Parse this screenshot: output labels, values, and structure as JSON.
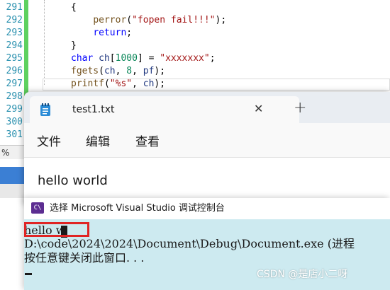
{
  "editor": {
    "line_numbers": [
      "291",
      "292",
      "293",
      "294",
      "295",
      "296",
      "297",
      "298",
      "299",
      "300",
      "301"
    ],
    "lines": [
      {
        "parts": [
          {
            "t": "{",
            "c": ""
          }
        ]
      },
      {
        "parts": [
          {
            "t": "    ",
            "c": ""
          },
          {
            "t": "perror",
            "c": "fn"
          },
          {
            "t": "(",
            "c": ""
          },
          {
            "t": "\"fopen fail!!!\"",
            "c": "str"
          },
          {
            "t": ");",
            "c": ""
          }
        ]
      },
      {
        "parts": [
          {
            "t": "    ",
            "c": ""
          },
          {
            "t": "return",
            "c": "kw"
          },
          {
            "t": ";",
            "c": ""
          }
        ]
      },
      {
        "parts": [
          {
            "t": "}",
            "c": ""
          }
        ]
      },
      {
        "parts": [
          {
            "t": "char",
            "c": "kw"
          },
          {
            "t": " ",
            "c": ""
          },
          {
            "t": "ch",
            "c": "vr"
          },
          {
            "t": "[",
            "c": ""
          },
          {
            "t": "1000",
            "c": "nm"
          },
          {
            "t": "] = ",
            "c": ""
          },
          {
            "t": "\"xxxxxxx\"",
            "c": "str"
          },
          {
            "t": ";",
            "c": ""
          }
        ]
      },
      {
        "parts": [
          {
            "t": "fgets",
            "c": "fn"
          },
          {
            "t": "(",
            "c": ""
          },
          {
            "t": "ch",
            "c": "vr"
          },
          {
            "t": ", ",
            "c": ""
          },
          {
            "t": "8",
            "c": "nm"
          },
          {
            "t": ", ",
            "c": ""
          },
          {
            "t": "pf",
            "c": "vr"
          },
          {
            "t": ");",
            "c": ""
          }
        ]
      },
      {
        "parts": [
          {
            "t": "printf",
            "c": "fn"
          },
          {
            "t": "(",
            "c": ""
          },
          {
            "t": "\"%s\"",
            "c": "str"
          },
          {
            "t": ", ",
            "c": ""
          },
          {
            "t": "ch",
            "c": "vr"
          },
          {
            "t": ");",
            "c": ""
          }
        ]
      }
    ],
    "zoom_fragment": "%"
  },
  "notepad": {
    "tab_title": "test1.txt",
    "close_glyph": "✕",
    "new_tab_glyph": "+",
    "menu": {
      "file": "文件",
      "edit": "编辑",
      "view": "查看"
    },
    "content": "hello world"
  },
  "console": {
    "icon_text": "C\\",
    "title": "选择 Microsoft Visual Studio 调试控制台",
    "output_line1": "hello w",
    "output_line2": "D:\\code\\2024\\2024\\Document\\Debug\\Document.exe (进程",
    "output_line3": "按任意键关闭此窗口. . ."
  },
  "watermark": "CSDN @是店小二呀",
  "colors": {
    "accent_green": "#5fd15f",
    "console_bg": "#cdeaf0",
    "highlight_red": "#e02424",
    "vs_purple": "#5c2d91"
  }
}
